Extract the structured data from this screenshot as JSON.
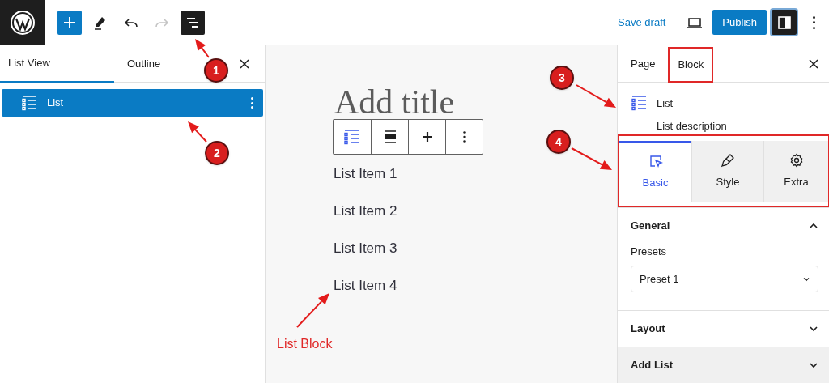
{
  "toolbar": {
    "tools": [
      {
        "kind": "add",
        "selected": true
      },
      {
        "kind": "edit",
        "selected": false
      },
      {
        "kind": "undo",
        "selected": false
      },
      {
        "kind": "redo",
        "disabled": true,
        "selected": false
      },
      {
        "kind": "list_view",
        "selected": true
      }
    ],
    "save_draft": "Save draft",
    "publish": "Publish",
    "settings_open": true
  },
  "list_view": {
    "tabs": [
      {
        "label": "List View",
        "selected": true
      },
      {
        "label": "Outline",
        "selected": false
      }
    ],
    "items": [
      {
        "label": "List",
        "selected": true
      }
    ]
  },
  "canvas": {
    "title_placeholder": "Add title",
    "items": [
      "List Item 1",
      "List Item 2",
      "List Item 3",
      "List Item 4"
    ]
  },
  "sidebar": {
    "tabs": [
      {
        "label": "Page",
        "selected": false
      },
      {
        "label": "Block",
        "selected": true
      }
    ],
    "block": {
      "name": "List",
      "description": "List description"
    },
    "style_tabs": [
      {
        "kind": "basic",
        "label": "Basic",
        "selected": true
      },
      {
        "kind": "style",
        "label": "Style",
        "selected": false
      },
      {
        "kind": "extra",
        "label": "Extra",
        "selected": false
      }
    ],
    "panels": [
      {
        "title": "General",
        "expanded": true,
        "highlighted": false,
        "fields": [
          {
            "label": "Presets",
            "value": "Preset 1"
          }
        ]
      },
      {
        "title": "Layout",
        "expanded": false,
        "highlighted": false
      },
      {
        "title": "Add List",
        "expanded": false,
        "highlighted": true
      }
    ]
  },
  "annotations": {
    "markers": [
      "1",
      "2",
      "3",
      "4"
    ],
    "caption": "List Block"
  }
}
